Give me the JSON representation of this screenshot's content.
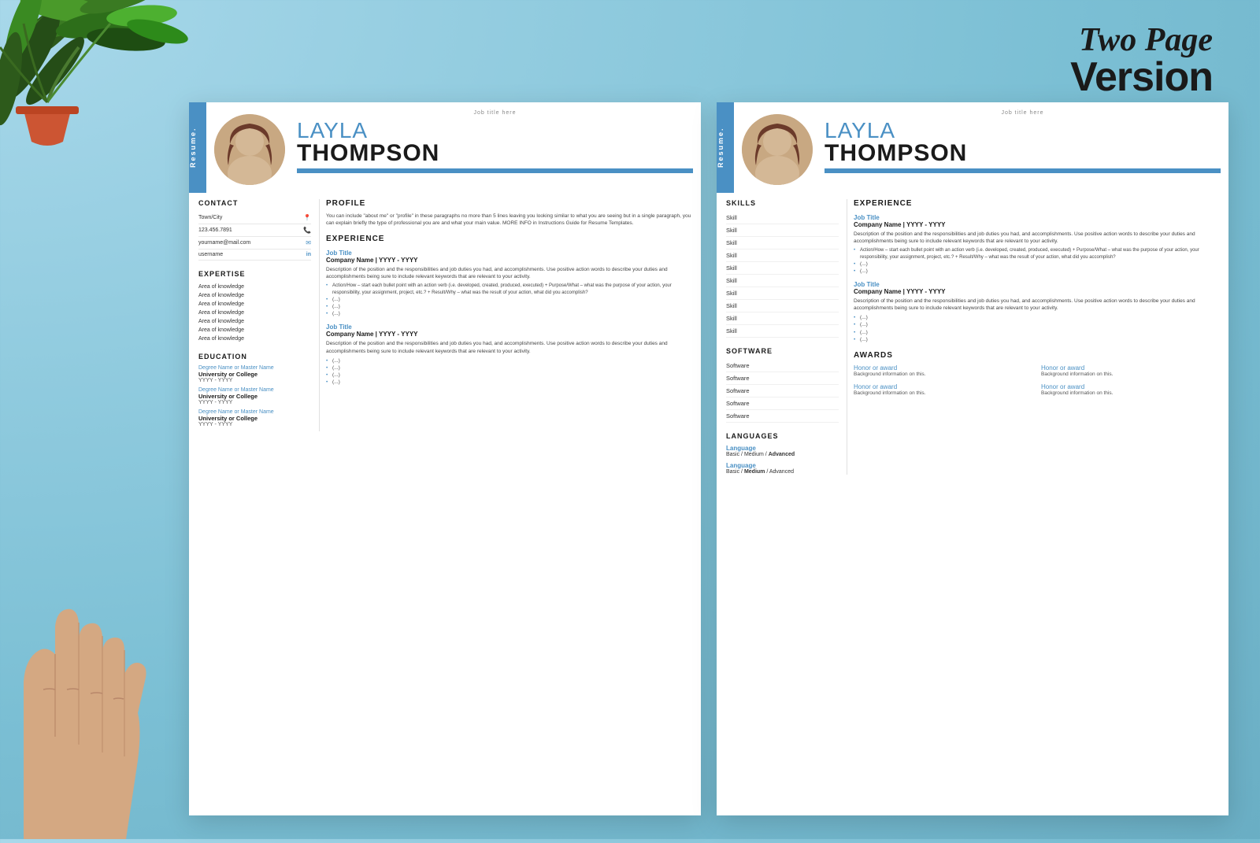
{
  "version_label": {
    "line1": "Two Page",
    "line2": "Version"
  },
  "page1": {
    "header": {
      "job_title": "Job title here",
      "sidebar_label": "Resume.",
      "name_first": "LAYLA",
      "name_last": "THOMPSON"
    },
    "contact": {
      "section_title": "CONTACT",
      "items": [
        {
          "label": "Town/City",
          "icon": "📍"
        },
        {
          "label": "123.456.7891",
          "icon": "📞"
        },
        {
          "label": "yourname@mail.com",
          "icon": "✉"
        },
        {
          "label": "username",
          "icon": "in"
        }
      ]
    },
    "expertise": {
      "section_title": "EXPERTISE",
      "items": [
        "Area of knowledge",
        "Area of knowledge",
        "Area of knowledge",
        "Area of knowledge",
        "Area of knowledge",
        "Area of knowledge",
        "Area of knowledge"
      ]
    },
    "education": {
      "section_title": "EDUCATION",
      "items": [
        {
          "degree": "Degree Name or Master Name",
          "university": "University or College",
          "year": "YYYY - YYYY"
        },
        {
          "degree": "Degree Name or Master Name",
          "university": "University or College",
          "year": "YYYY - YYYY"
        },
        {
          "degree": "Degree Name or Master Name",
          "university": "University or College",
          "year": "YYYY - YYYY"
        }
      ]
    },
    "profile": {
      "section_title": "PROFILE",
      "text": "You can include \"about me\" or \"profile\" in these paragraphs no more than 5 lines leaving you looking similar to what you are seeing but in a single paragraph, you can explain briefly the type of professional you are and what your main value. MORE INFO in Instructions Guide for Resume Templates."
    },
    "experience": {
      "section_title": "EXPERIENCE",
      "jobs": [
        {
          "job_title": "Job Title",
          "company": "Company Name | YYYY - YYYY",
          "description": "Description of the position and the responsibilities and job duties you had, and accomplishments. Use positive action words to describe your duties and accomplishments being sure to include relevant keywords that are relevant to your activity.",
          "bullet": "• Action/How – start each bullet point with an action verb (i.e. developed, created, produced, executed) + Purpose/What – what was the purpose of your action, your responsibility, your assignment, project, etc.? + Result/Why – what was the result of your action, what did you accomplish?",
          "extra_bullets": [
            "• (...)",
            "• (...)",
            "• (...)"
          ]
        },
        {
          "job_title": "Job Title",
          "company": "Company Name | YYYY - YYYY",
          "description": "Description of the position and the responsibilities and job duties you had, and accomplishments. Use positive action words to describe your duties and accomplishments being sure to include relevant keywords that are relevant to your activity.",
          "bullet": "",
          "extra_bullets": [
            "• (...)",
            "• (...)",
            "• (...)",
            "• (...)"
          ]
        }
      ]
    }
  },
  "page2": {
    "header": {
      "job_title": "Job title here",
      "sidebar_label": "Resume.",
      "name_first": "LAYLA",
      "name_last": "THOMPSON"
    },
    "skills": {
      "section_title": "SKILLS",
      "items": [
        "Skill",
        "Skill",
        "Skill",
        "Skill",
        "Skill",
        "Skill",
        "Skill",
        "Skill",
        "Skill",
        "Skill"
      ]
    },
    "software": {
      "section_title": "SOFTWARE",
      "items": [
        "Software",
        "Software",
        "Software",
        "Software",
        "Software"
      ]
    },
    "languages": {
      "section_title": "LANGUAGES",
      "items": [
        {
          "name": "Language",
          "level": "Basic / Medium / Advanced"
        },
        {
          "name": "Language",
          "level": "Basic / Medium / Advanced"
        }
      ]
    },
    "experience": {
      "section_title": "EXPERIENCE",
      "jobs": [
        {
          "job_title": "Job Title",
          "company": "Company Name | YYYY - YYYY",
          "description": "Description of the position and the responsibilities and job duties you had, and accomplishments. Use positive action words to describe your duties and accomplishments being sure to include relevant keywords that are relevant to your activity.",
          "bullet": "• Action/How – start each bullet point with an action verb (i.e. developed, created, produced, executed) + Purpose/What – what was the purpose of your action, your responsibility, your assignment, project, etc.? + Result/Why – what was the result of your action, what did you accomplish?",
          "extra_bullets": [
            "• (...)",
            "• (...)",
            "• (...)"
          ]
        },
        {
          "job_title": "Job Title",
          "company": "Company Name | YYYY - YYYY",
          "description": "Description of the position and the responsibilities and job duties you had, and accomplishments. Use positive action words to describe your duties and accomplishments being sure to include relevant keywords that are relevant to your activity.",
          "extra_bullets": [
            "• (...)",
            "• (...)",
            "• (...)",
            "• (...)"
          ]
        }
      ]
    },
    "awards": {
      "section_title": "AWARDS",
      "rows": [
        {
          "items": [
            {
              "title": "Honor or award",
              "desc": "Background information on this."
            },
            {
              "title": "Honor or award",
              "desc": "Background information on this."
            }
          ]
        },
        {
          "items": [
            {
              "title": "Honor or award",
              "desc": "Background information on this."
            },
            {
              "title": "Honor or award",
              "desc": "Background information on this."
            }
          ]
        }
      ]
    }
  }
}
